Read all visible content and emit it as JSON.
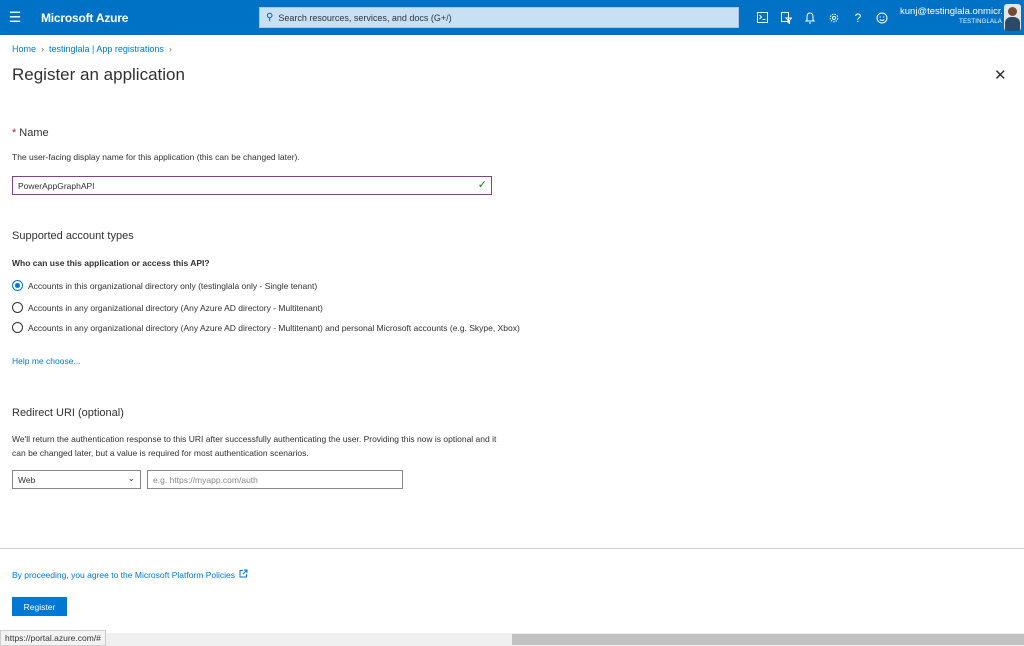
{
  "header": {
    "menu_icon": "hamburger-icon",
    "brand": "Microsoft Azure",
    "search_placeholder": "Search resources, services, and docs (G+/)",
    "icons": [
      "cloud-shell-icon",
      "directory-filter-icon",
      "bell-icon",
      "gear-icon",
      "help-icon",
      "feedback-icon"
    ],
    "user": "kunj@testinglala.onmicr...",
    "tenant": "TESTINGLALA"
  },
  "breadcrumb": {
    "home": "Home",
    "parent": "testinglala | App registrations"
  },
  "page": {
    "title": "Register an application"
  },
  "name_section": {
    "required_mark": "*",
    "label": "Name",
    "description": "The user-facing display name for this application (this can be changed later).",
    "value": "PowerAppGraphAPI"
  },
  "account_types": {
    "title": "Supported account types",
    "question": "Who can use this application or access this API?",
    "options": [
      {
        "label": "Accounts in this organizational directory only (testinglala only - Single tenant)",
        "selected": true
      },
      {
        "label": "Accounts in any organizational directory (Any Azure AD directory - Multitenant)",
        "selected": false
      },
      {
        "label": "Accounts in any organizational directory (Any Azure AD directory - Multitenant) and personal Microsoft accounts (e.g. Skype, Xbox)",
        "selected": false
      }
    ],
    "help_link": "Help me choose..."
  },
  "redirect": {
    "title": "Redirect URI (optional)",
    "description": "We'll return the authentication response to this URI after successfully authenticating the user. Providing this now is optional and it can be changed later, but a value is required for most authentication scenarios.",
    "platform": "Web",
    "uri_placeholder": "e.g. https://myapp.com/auth"
  },
  "footer": {
    "policy_text": "By proceeding, you agree to the Microsoft Platform Policies",
    "register_label": "Register"
  },
  "status": {
    "url": "https://portal.azure.com/#"
  }
}
